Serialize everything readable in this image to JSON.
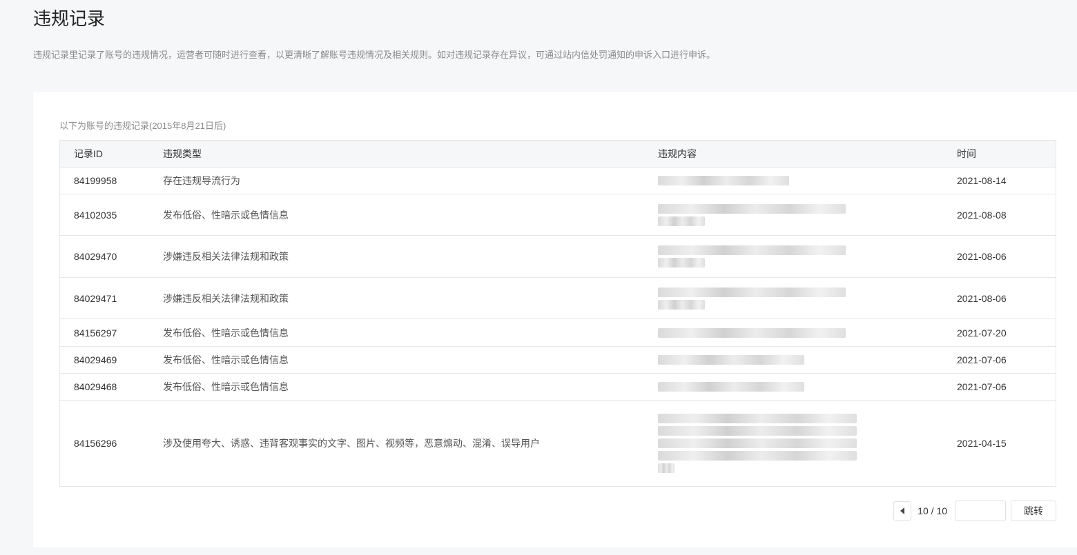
{
  "page": {
    "title": "违规记录",
    "description": "违规记录里记录了账号的违规情况，运营者可随时进行查看，以更清晰了解账号违规情况及相关规则。如对违规记录存在异议，可通过站内信处罚通知的申诉入口进行申诉。"
  },
  "table": {
    "caption": "以下为账号的违规记录(2015年8月21日后)",
    "headers": {
      "id": "记录ID",
      "type": "违规类型",
      "content": "违规内容",
      "time": "时间"
    },
    "rows": [
      {
        "id": "84199958",
        "type": "存在违规导流行为",
        "time": "2021-08-14"
      },
      {
        "id": "84102035",
        "type": "发布低俗、性暗示或色情信息",
        "time": "2021-08-08"
      },
      {
        "id": "84029470",
        "type": "涉嫌违反相关法律法规和政策",
        "time": "2021-08-06"
      },
      {
        "id": "84029471",
        "type": "涉嫌违反相关法律法规和政策",
        "time": "2021-08-06"
      },
      {
        "id": "84156297",
        "type": "发布低俗、性暗示或色情信息",
        "time": "2021-07-20"
      },
      {
        "id": "84029469",
        "type": "发布低俗、性暗示或色情信息",
        "time": "2021-07-06"
      },
      {
        "id": "84029468",
        "type": "发布低俗、性暗示或色情信息",
        "time": "2021-07-06"
      },
      {
        "id": "84156296",
        "type": "涉及使用夸大、诱惑、违背客观事实的文字、图片、视频等，恶意煽动、混淆、误导用户",
        "time": "2021-04-15"
      }
    ]
  },
  "pagination": {
    "page_info": "10 / 10",
    "input_value": "",
    "jump_label": "跳转"
  }
}
